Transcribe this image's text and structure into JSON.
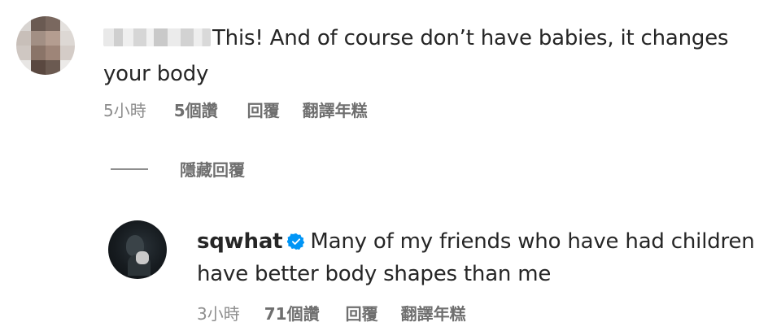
{
  "comment": {
    "text": "This! And of course don’t have babies, it changes your body",
    "time": "5小時",
    "likes": "5個讚",
    "reply_label": "回覆",
    "translate_label": "翻譯年糕"
  },
  "hide_replies_label": "隱藏回覆",
  "reply": {
    "username": "sqwhat",
    "verified_icon": "verified-badge-icon",
    "text": "Many of my friends who have had children have better body shapes than me",
    "time": "3小時",
    "likes": "71個讚",
    "reply_label": "回覆",
    "translate_label": "翻譯年糕"
  },
  "colors": {
    "text": "#262626",
    "meta": "#8e8e8e",
    "verified": "#0095f6"
  }
}
